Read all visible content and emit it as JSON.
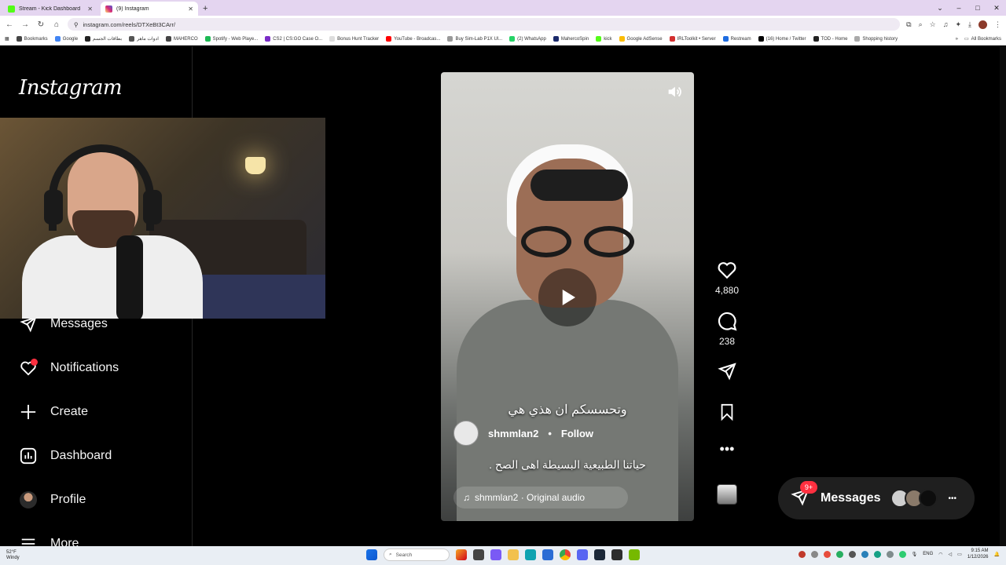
{
  "browser": {
    "tabs": [
      {
        "title": "Stream - Kick Dashboard",
        "favicon_color": "#53fc18",
        "active": false
      },
      {
        "title": "(9) Instagram",
        "favicon_color": "#d62976",
        "active": true
      }
    ],
    "new_tab_label": "+",
    "window_controls": {
      "minimize": "–",
      "maximize": "□",
      "close": "✕"
    },
    "address": "instagram.com/reels/DTXeBt3CArr/",
    "bookmarks": [
      {
        "label": "Bookmarks",
        "color": "#444444"
      },
      {
        "label": "Google",
        "color": "#4285f4"
      },
      {
        "label": "بطاقات الجسم",
        "color": "#222222"
      },
      {
        "label": "ادوات ماهر",
        "color": "#555555"
      },
      {
        "label": "MAHERCO",
        "color": "#444444"
      },
      {
        "label": "Spotify - Web Playe...",
        "color": "#1db954"
      },
      {
        "label": "CS2 | CS:GO Case O...",
        "color": "#7a2cc7"
      },
      {
        "label": "Bonus Hunt Tracker",
        "color": "#dddddd"
      },
      {
        "label": "YouTube - Broadcas...",
        "color": "#ff0000"
      },
      {
        "label": "Buy Sim-Lab P1X Ul...",
        "color": "#999999"
      },
      {
        "label": "(2) WhatsApp",
        "color": "#25d366"
      },
      {
        "label": "MahercoSpin",
        "color": "#1b2a6b"
      },
      {
        "label": "kick",
        "color": "#53fc18"
      },
      {
        "label": "Google AdSense",
        "color": "#fbbc04"
      },
      {
        "label": "IRLToolkit • Server",
        "color": "#d32f2f"
      },
      {
        "label": "Restream",
        "color": "#1e6ce0"
      },
      {
        "label": "(16) Home / Twitter",
        "color": "#000000"
      },
      {
        "label": "TOD - Home",
        "color": "#222222"
      },
      {
        "label": "Shopping history",
        "color": "#aaaaaa"
      }
    ],
    "bookmarks_more": "»",
    "all_bookmarks": "All Bookmarks"
  },
  "instagram": {
    "logo": "Instagram",
    "nav": {
      "messages": "Messages",
      "notifications": "Notifications",
      "create": "Create",
      "dashboard": "Dashboard",
      "profile": "Profile",
      "more": "More"
    },
    "reel": {
      "subtitle_top": "وتحسسكم ان هذي هي",
      "username": "shmmlan2",
      "follow": "Follow",
      "separator": "•",
      "caption": "حياتنا الطبيعية البسيطة اهى الصح .",
      "audio": "shmmlan2 · Original audio"
    },
    "actions": {
      "likes": "4,880",
      "comments": "238"
    },
    "messages_pill": {
      "label": "Messages",
      "badge": "9+"
    }
  },
  "taskbar": {
    "weather_temp": "52°F",
    "weather_desc": "Windy",
    "search_placeholder": "Search",
    "language": "ENG",
    "time": "9:15 AM",
    "date": "1/12/2026"
  },
  "colors": {
    "ig_background": "#000000",
    "notification_red": "#ff3040",
    "browser_tabbar": "#e4d5f0"
  }
}
